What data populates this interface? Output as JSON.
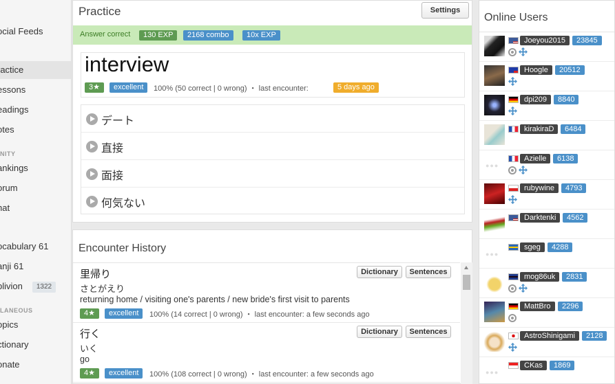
{
  "sidebar": {
    "items": [
      {
        "label": "ocial Feeds"
      },
      {
        "label": "ractice"
      },
      {
        "label": "essons"
      },
      {
        "label": "eadings"
      },
      {
        "label": "otes"
      },
      {
        "label": "ankings"
      },
      {
        "label": "orum"
      },
      {
        "label": "hat"
      },
      {
        "label": "ocabulary 61"
      },
      {
        "label": "anji 61"
      },
      {
        "label": "blivion",
        "count": "1322"
      },
      {
        "label": "opics"
      },
      {
        "label": "ctionary"
      },
      {
        "label": "onate"
      }
    ],
    "sections": [
      "NITY",
      "LANEOUS"
    ]
  },
  "practice": {
    "title": "Practice",
    "settings_label": "Settings",
    "answer_status": "Answer correct",
    "exp": "130 EXP",
    "combo": "2168 combo",
    "multiplier": "10x EXP",
    "word": "interview",
    "level": "3★",
    "quality": "excellent",
    "stats": "100% (50 correct | 0 wrong)  ・ last encounter:",
    "last_encounter": "5 days ago",
    "choices": [
      "デート",
      "直接",
      "面接",
      "何気ない"
    ]
  },
  "history": {
    "title": "Encounter History",
    "dictionary_label": "Dictionary",
    "sentences_label": "Sentences",
    "entries": [
      {
        "kanji": "里帰り",
        "kana": "さとがえり",
        "meaning": "returning home / visiting one's parents / new bride's first visit to parents",
        "level": "4★",
        "quality": "excellent",
        "stats": "100% (14 correct | 0 wrong)  ・ last encounter: a few seconds ago"
      },
      {
        "kanji": "行く",
        "kana": "いく",
        "meaning": "go",
        "level": "4★",
        "quality": "excellent",
        "stats": "100% (108 correct | 0 wrong)  ・ last encounter: a few seconds ago"
      }
    ]
  },
  "online": {
    "title": "Online Users",
    "users": [
      {
        "name": "Joeyou2015",
        "score": "23845",
        "flag": "us",
        "avatar": "dark-figure",
        "icons": [
          "ring",
          "move"
        ]
      },
      {
        "name": "Hoogle",
        "score": "20512",
        "flag": "tw",
        "avatar": "anime-dark",
        "icons": [
          "move"
        ]
      },
      {
        "name": "dpi209",
        "score": "8840",
        "flag": "de",
        "avatar": "blue-emblem",
        "icons": [
          "move"
        ]
      },
      {
        "name": "kirakiraD",
        "score": "6484",
        "flag": "fr",
        "avatar": "light-blue",
        "icons": []
      },
      {
        "name": "Azielle",
        "score": "6138",
        "flag": "fr",
        "avatar": "none",
        "icons": [
          "ring",
          "move"
        ]
      },
      {
        "name": "rubywine",
        "score": "4793",
        "flag": "cz",
        "avatar": "red-hair",
        "icons": [
          "move"
        ]
      },
      {
        "name": "Darktenki",
        "score": "4562",
        "flag": "us",
        "avatar": "books",
        "icons": []
      },
      {
        "name": "sgeg",
        "score": "4288",
        "flag": "se",
        "avatar": "none",
        "icons": []
      },
      {
        "name": "mog86uk",
        "score": "2831",
        "flag": "gb",
        "avatar": "yellow-char",
        "icons": [
          "ring",
          "move"
        ]
      },
      {
        "name": "MattBro",
        "score": "2296",
        "flag": "de",
        "avatar": "blue-scene",
        "icons": [
          "ring"
        ]
      },
      {
        "name": "AstroShinigami",
        "score": "2128",
        "flag": "jp",
        "avatar": "fox-girl",
        "icons": [
          "move"
        ]
      },
      {
        "name": "CKas",
        "score": "1869",
        "flag": "sg",
        "avatar": "none",
        "icons": []
      }
    ]
  },
  "colors": {
    "answer_bar": "#c9eab8",
    "green_badge": "#5e9b52",
    "blue_badge": "#4a90c9",
    "orange_badge": "#f0ad2c",
    "username_badge": "#444444"
  }
}
